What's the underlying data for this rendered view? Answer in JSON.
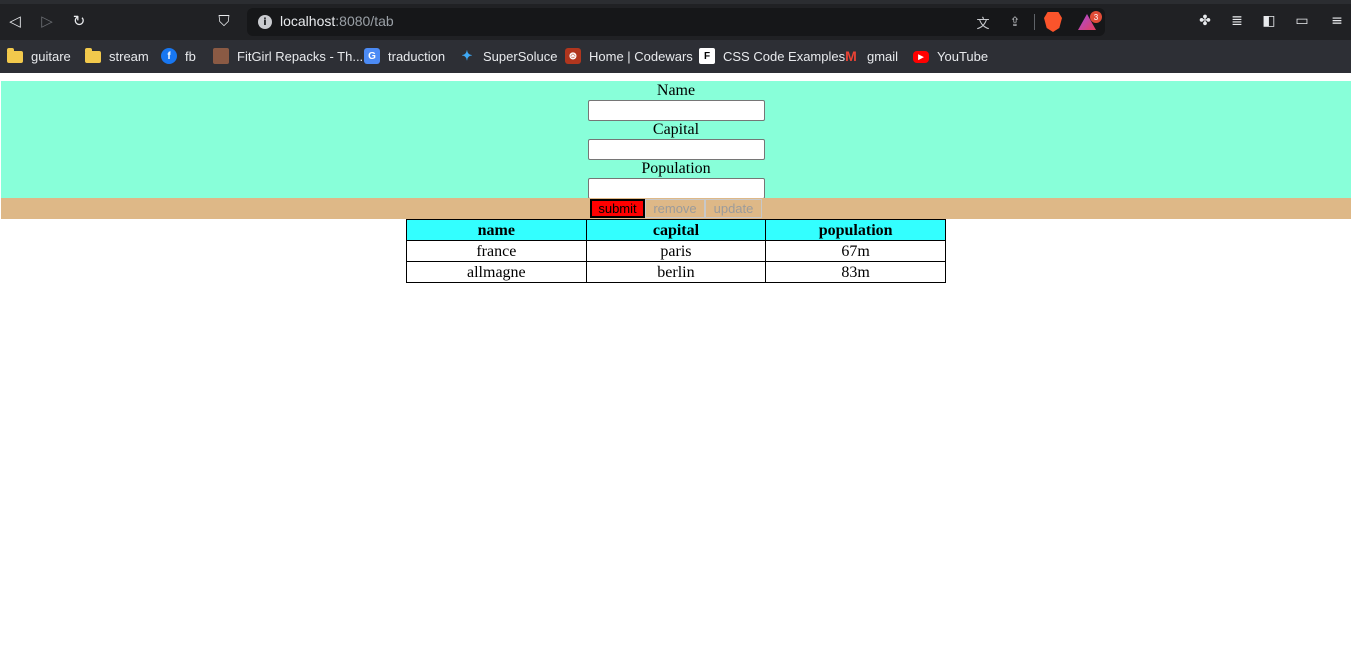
{
  "browser": {
    "url_host": "localhost",
    "url_path": ":8080/tab",
    "rewards_badge_count": "3",
    "bookmarks": [
      {
        "label": "guitare",
        "icon": "folder-icon"
      },
      {
        "label": "stream",
        "icon": "folder-icon"
      },
      {
        "label": "fb",
        "icon": "facebook-icon"
      },
      {
        "label": "FitGirl Repacks - Th...",
        "icon": "fitgirl-favicon"
      },
      {
        "label": "traduction",
        "icon": "google-translate-icon"
      },
      {
        "label": "SuperSoluce",
        "icon": "supersoluce-icon"
      },
      {
        "label": "Home | Codewars",
        "icon": "codewars-icon"
      },
      {
        "label": "CSS Code Examples",
        "icon": "css-examples-icon"
      },
      {
        "label": "gmail",
        "icon": "gmail-icon"
      },
      {
        "label": "YouTube",
        "icon": "youtube-icon"
      }
    ]
  },
  "form": {
    "name_label": "Name",
    "name_value": "",
    "capital_label": "Capital",
    "capital_value": "",
    "population_label": "Population",
    "population_value": "",
    "background_color": "#88ffd9"
  },
  "buttons": {
    "submit": "submit",
    "remove": "remove",
    "update": "update",
    "bar_color": "#deb887",
    "submit_color": "#ff0000"
  },
  "table": {
    "headers": [
      "name",
      "capital",
      "population"
    ],
    "header_color": "#33ffff",
    "rows": [
      [
        "france",
        "paris",
        "67m"
      ],
      [
        "allmagne",
        "berlin",
        "83m"
      ]
    ]
  }
}
